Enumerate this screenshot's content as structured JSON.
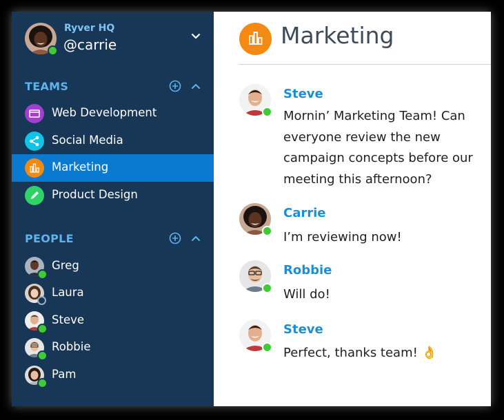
{
  "org": {
    "name": "Ryver HQ",
    "user_handle": "@carrie",
    "chevron_icon": "chevron-down-icon",
    "status": "online"
  },
  "teams_section": {
    "title": "TEAMS",
    "add_icon": "plus-circle-icon",
    "collapse_icon": "chevron-up-icon",
    "items": [
      {
        "label": "Web Development",
        "icon": "browser-icon",
        "color": "#a03fd0",
        "active": false
      },
      {
        "label": "Social Media",
        "icon": "share-icon",
        "color": "#10c4e8",
        "active": false
      },
      {
        "label": "Marketing",
        "icon": "bar-chart-icon",
        "color": "#f58a12",
        "active": true
      },
      {
        "label": "Product Design",
        "icon": "pencil-icon",
        "color": "#2fd168",
        "active": false
      }
    ]
  },
  "people_section": {
    "title": "PEOPLE",
    "add_icon": "plus-circle-icon",
    "collapse_icon": "chevron-up-icon",
    "items": [
      {
        "label": "Greg",
        "status": "online"
      },
      {
        "label": "Laura",
        "status": "away"
      },
      {
        "label": "Steve",
        "status": "online"
      },
      {
        "label": "Robbie",
        "status": "online"
      },
      {
        "label": "Pam",
        "status": "online"
      }
    ]
  },
  "channel": {
    "title": "Marketing",
    "icon": "bar-chart-icon",
    "color": "#f58a12"
  },
  "messages": [
    {
      "author": "Steve",
      "lines": [
        "Mornin’ Marketing Team! Can",
        "everyone review the new",
        "campaign concepts before our",
        "meeting this afternoon?"
      ]
    },
    {
      "author": "Carrie",
      "lines": [
        "I’m reviewing now!"
      ]
    },
    {
      "author": "Robbie",
      "lines": [
        "Will do!"
      ]
    },
    {
      "author": "Steve",
      "lines": [
        "Perfect, thanks team! 👌"
      ]
    }
  ],
  "colors": {
    "sidebar_bg": "#183656",
    "active_bg": "#0a7ad0",
    "section_title": "#5eb3ec",
    "author_name": "#1c8fd4",
    "online": "#3ecb35"
  }
}
